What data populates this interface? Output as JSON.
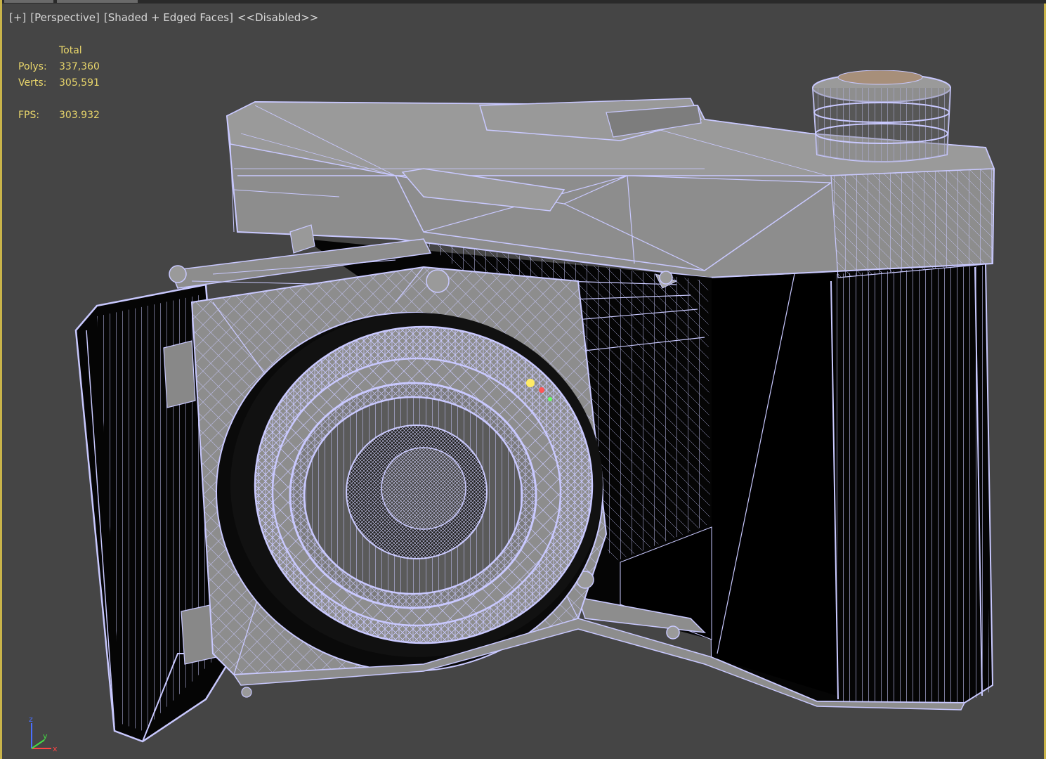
{
  "viewport": {
    "labels": [
      "[+]",
      "[Perspective]",
      "[Shaded + Edged Faces]",
      "<<Disabled>>"
    ],
    "border_color": "#c9b44a",
    "background": "#454545"
  },
  "stats": {
    "header": "Total",
    "polys_label": "Polys:",
    "polys_value": "337,360",
    "verts_label": "Verts:",
    "verts_value": "305,591",
    "fps_label": "FPS:",
    "fps_value": "303.932",
    "color": "#e9d66b"
  },
  "model": {
    "wire_color": "#c9c9ff",
    "shade_color": "#8d8d8d",
    "dark_color": "#050505"
  },
  "gizmo": {
    "z": "z",
    "y": "y",
    "x": "x"
  }
}
